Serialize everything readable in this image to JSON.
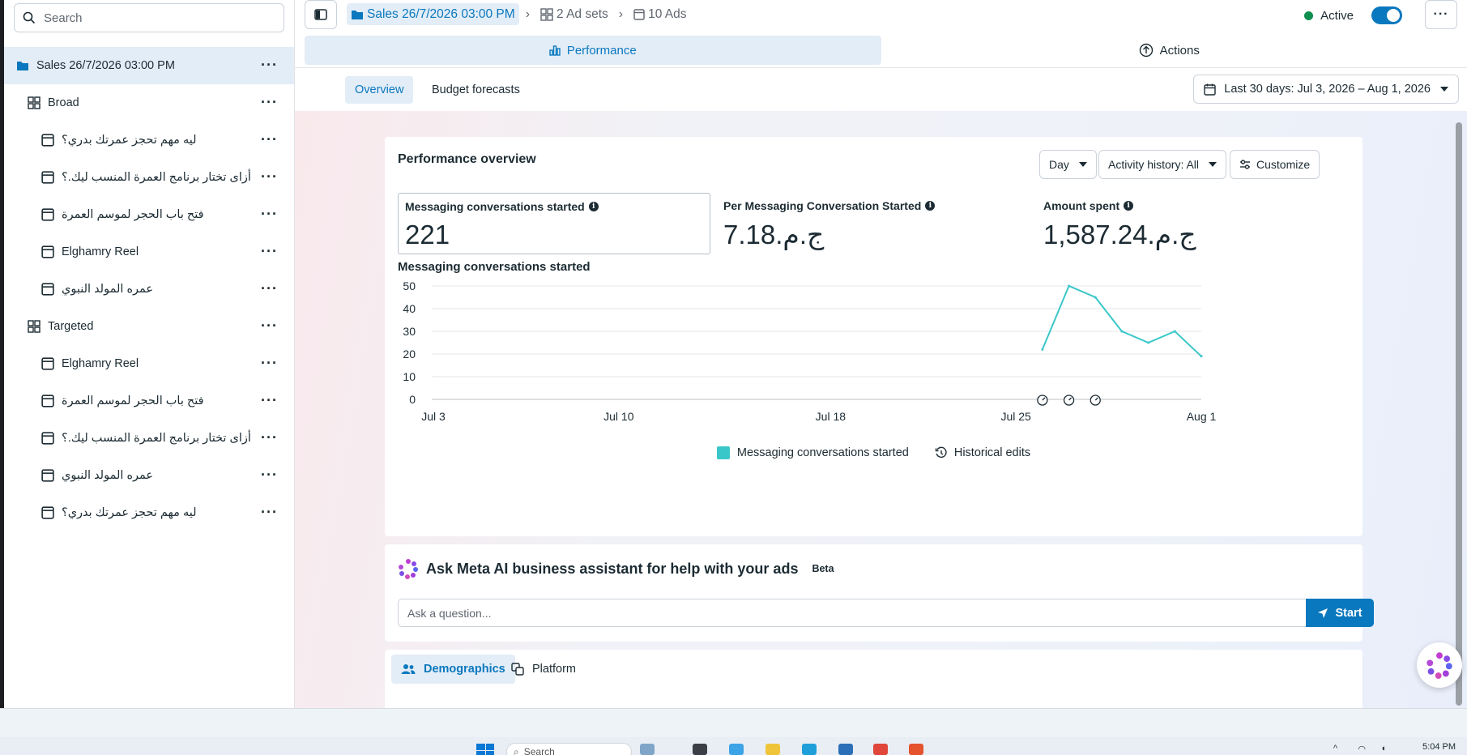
{
  "sidebar": {
    "search_placeholder": "Search",
    "items": [
      {
        "label": "Sales 26/7/2026 03:00 PM",
        "level": 0,
        "kind": "campaign",
        "selected": true
      },
      {
        "label": "Broad",
        "level": 1,
        "kind": "adset"
      },
      {
        "label": "ليه مهم تحجز عمرتك بدري؟",
        "level": 2,
        "kind": "ad"
      },
      {
        "label": "أزاى تختار برنامج العمرة المنسب ليك.؟",
        "level": 2,
        "kind": "ad"
      },
      {
        "label": "فتح باب الحجر لموسم العمرة",
        "level": 2,
        "kind": "ad"
      },
      {
        "label": "Elghamry Reel",
        "level": 2,
        "kind": "ad"
      },
      {
        "label": "عمره المولد النبوي",
        "level": 2,
        "kind": "ad"
      },
      {
        "label": "Targeted",
        "level": 1,
        "kind": "adset"
      },
      {
        "label": "Elghamry Reel",
        "level": 2,
        "kind": "ad"
      },
      {
        "label": "فتح باب الحجر لموسم العمرة",
        "level": 2,
        "kind": "ad"
      },
      {
        "label": "أزاى تختار برنامج العمرة المنسب ليك.؟",
        "level": 2,
        "kind": "ad"
      },
      {
        "label": "عمره المولد النبوي",
        "level": 2,
        "kind": "ad"
      },
      {
        "label": "ليه مهم تحجز عمرتك بدري؟",
        "level": 2,
        "kind": "ad"
      }
    ]
  },
  "header": {
    "breadcrumb": {
      "campaign": "Sales 26/7/2026 03:00 PM",
      "adsets": "2 Ad sets",
      "ads": "10 Ads"
    },
    "status_label": "Active",
    "status_color": "#0e8f4f",
    "tabs": {
      "performance": "Performance",
      "actions": "Actions"
    }
  },
  "subtabs": {
    "overview": "Overview",
    "budget": "Budget forecasts",
    "date_range": "Last 30 days: Jul 3, 2026 – Aug 1, 2026"
  },
  "performance": {
    "title": "Performance overview",
    "day_label": "Day",
    "activity_label": "Activity history: All",
    "customize_label": "Customize",
    "metrics": [
      {
        "label": "Messaging conversations started",
        "value": "221"
      },
      {
        "label": "Per Messaging Conversation Started",
        "value": "ج.م.7.18"
      },
      {
        "label": "Amount spent",
        "value": "ج.م.1,587.24"
      }
    ],
    "chart_title": "Messaging conversations started",
    "legend_series": "Messaging conversations started",
    "legend_edits": "Historical edits"
  },
  "chart_data": {
    "type": "line",
    "x": [
      "Jul 26",
      "Jul 27",
      "Jul 28",
      "Jul 29",
      "Jul 30",
      "Jul 31",
      "Aug 1"
    ],
    "series": [
      {
        "name": "Messaging conversations started",
        "values": [
          22,
          50,
          45,
          30,
          25,
          30,
          19
        ]
      }
    ],
    "x_range": [
      "Jul 3",
      "Aug 1"
    ],
    "x_ticks": [
      "Jul 3",
      "Jul 10",
      "Jul 18",
      "Jul 25",
      "Aug 1"
    ],
    "y_ticks": [
      0,
      10,
      20,
      30,
      40,
      50
    ],
    "ylim": [
      0,
      50
    ],
    "historical_edits": [
      "Jul 26",
      "Jul 27",
      "Jul 28"
    ],
    "grid": true,
    "legend": "bottom",
    "color": "#3ac7c9"
  },
  "ai": {
    "title": "Ask Meta AI business assistant for help with your ads",
    "badge": "Beta",
    "placeholder": "Ask a question...",
    "start_label": "Start"
  },
  "breakdown": {
    "demographics": "Demographics",
    "platform": "Platform"
  },
  "taskbar": {
    "search_placeholder": "Search",
    "time": "5:04 PM"
  },
  "colors": {
    "accent": "#0a78be",
    "selected_bg": "#e3edf7",
    "line": "#3ac7c9"
  }
}
